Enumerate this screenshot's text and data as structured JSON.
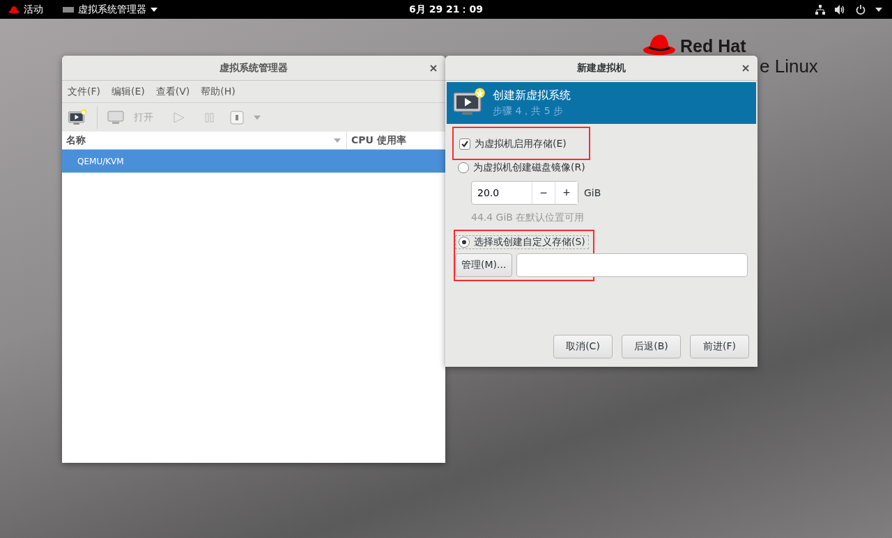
{
  "top_bar": {
    "activities": "活动",
    "app_menu": "虚拟系统管理器",
    "clock": "6月 29  21：09"
  },
  "wallpaper": {
    "brand": "Red Hat",
    "product": "e Linux"
  },
  "manager_window": {
    "title": "虚拟系统管理器",
    "menus": [
      "文件(F)",
      "编辑(E)",
      "查看(V)",
      "帮助(H)"
    ],
    "open_label": "打开",
    "columns": [
      "名称",
      "CPU 使用率"
    ],
    "rows": [
      {
        "name": "QEMU/KVM",
        "selected": true
      }
    ]
  },
  "dialog": {
    "title": "新建虚拟机",
    "banner": {
      "title": "创建新虚拟系统",
      "subtitle": "步骤 4，共 5 步"
    },
    "enable_storage": {
      "label": "为虚拟机启用存储(E)",
      "checked": true,
      "highlighted": true
    },
    "storage_options": [
      {
        "label": "为虚拟机创建磁盘镜像(R)",
        "selected": false
      },
      {
        "label": "选择或创建自定义存储(S)",
        "selected": true
      }
    ],
    "custom_storage_frame": {
      "highlighted": true
    },
    "disk_size": {
      "value": "20.0",
      "minus": "−",
      "plus": "+",
      "unit": "GiB"
    },
    "free_space": "44.4 GiB 在默认位置可用",
    "manage_button": "管理(M)...",
    "buttons": [
      "取消(C)",
      "后退(B)",
      "前进(F)"
    ]
  }
}
